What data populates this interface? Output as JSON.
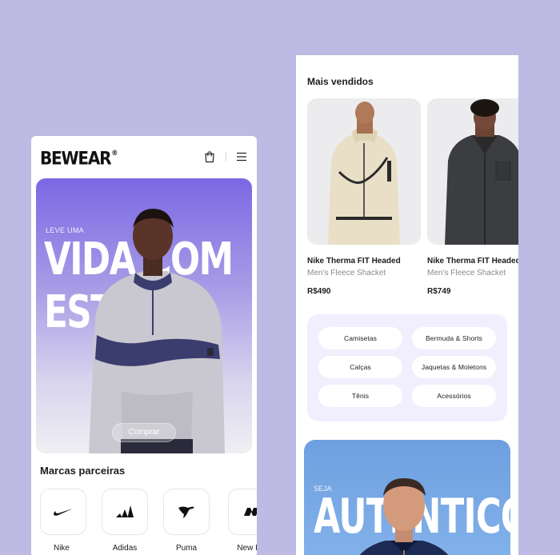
{
  "left_screen": {
    "logo": "BEWEAR",
    "logo_mark": "®",
    "icons": {
      "cart": "shopping-bag-icon",
      "menu": "hamburger-menu-icon"
    },
    "hero": {
      "kicker": "LEVE UMA",
      "headline_line1": "VIDA COM",
      "headline_line2": "ESTILO",
      "button_label": "Comprar"
    },
    "brands_title": "Marcas parceiras",
    "brands": [
      {
        "label": "Nike",
        "icon": "nike-swoosh-icon"
      },
      {
        "label": "Adidas",
        "icon": "adidas-logo-icon"
      },
      {
        "label": "Puma",
        "icon": "puma-logo-icon"
      },
      {
        "label": "New Bal",
        "icon": "new-balance-logo-icon"
      }
    ]
  },
  "right_screen": {
    "section_title": "Mais vendidos",
    "products": [
      {
        "name": "Nike Therma FIT Headed",
        "description": "Men’s Fleece Shacket",
        "price": "R$490"
      },
      {
        "name": "Nike Therma FIT Headed",
        "description": "Men’s Fleece Shacket",
        "price": "R$749"
      }
    ],
    "categories": [
      "Camisetas",
      "Bermuda & Shorts",
      "Calças",
      "Jaquetas & Moletons",
      "Tênis",
      "Acessórios"
    ],
    "hero2": {
      "kicker": "SEJA",
      "headline": "AUTÊNTICO"
    }
  },
  "colors": {
    "background": "#bdbae3",
    "hero_purple": "#7b68e4",
    "hero_blue": "#6e9fe0",
    "category_panel": "#f1eefe"
  }
}
